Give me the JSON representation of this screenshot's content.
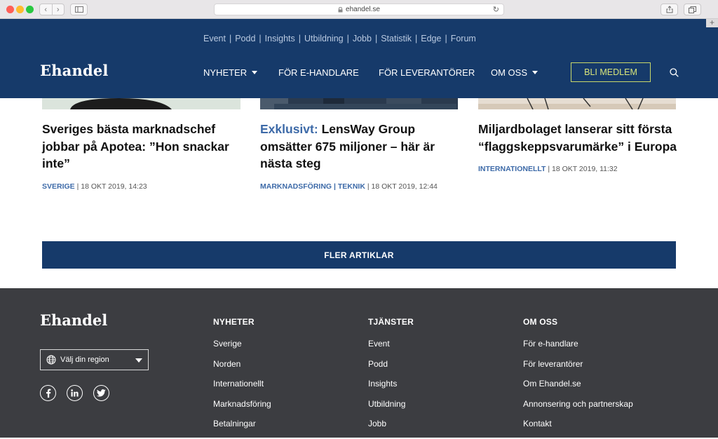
{
  "browser": {
    "url": "ehandel.se"
  },
  "header": {
    "logo": "Ehandel",
    "topnav": [
      "Event",
      "Podd",
      "Insights",
      "Utbildning",
      "Jobb",
      "Statistik",
      "Edge",
      "Forum"
    ],
    "topnav_separator": "|",
    "mainnav": [
      {
        "label": "NYHETER",
        "dropdown": true
      },
      {
        "label": "FÖR E-HANDLARE",
        "dropdown": false
      },
      {
        "label": "FÖR LEVERANTÖRER",
        "dropdown": false
      },
      {
        "label": "OM OSS",
        "dropdown": true
      }
    ],
    "member_button": "BLI MEDLEM"
  },
  "articles": [
    {
      "kicker": "",
      "title": "Sveriges bästa marknadschef jobbar på Apotea: ”Hon snackar inte”",
      "categories": "SVERIGE",
      "separator": "|",
      "date": "18 OKT 2019, 14:23"
    },
    {
      "kicker": "Exklusivt:",
      "title": "LensWay Group omsätter 675 miljoner – här är nästa steg",
      "categories": "MARKNADSFÖRING | TEKNIK",
      "separator": "|",
      "date": "18 OKT 2019, 12:44"
    },
    {
      "kicker": "",
      "title": "Miljardbolaget lanserar sitt första “flaggskeppsvarumärke” i Europa",
      "categories": "INTERNATIONELLT",
      "separator": "|",
      "date": "18 OKT 2019, 11:32"
    }
  ],
  "more_button": "FLER ARTIKLAR",
  "footer": {
    "logo": "Ehandel",
    "region_select": "Välj din region",
    "social": [
      "facebook-icon",
      "linkedin-icon",
      "twitter-icon"
    ],
    "columns": [
      {
        "heading": "NYHETER",
        "links": [
          "Sverige",
          "Norden",
          "Internationellt",
          "Marknadsföring",
          "Betalningar"
        ]
      },
      {
        "heading": "TJÄNSTER",
        "links": [
          "Event",
          "Podd",
          "Insights",
          "Utbildning",
          "Jobb"
        ]
      },
      {
        "heading": "OM OSS",
        "links": [
          "För e-handlare",
          "För leverantörer",
          "Om Ehandel.se",
          "Annonsering och partnerskap",
          "Kontakt"
        ]
      }
    ]
  },
  "colors": {
    "brand_navy": "#163a6a",
    "accent_blue": "#3d6aa8",
    "member_green": "#c9d86a",
    "footer_bg": "#3c3d41"
  }
}
